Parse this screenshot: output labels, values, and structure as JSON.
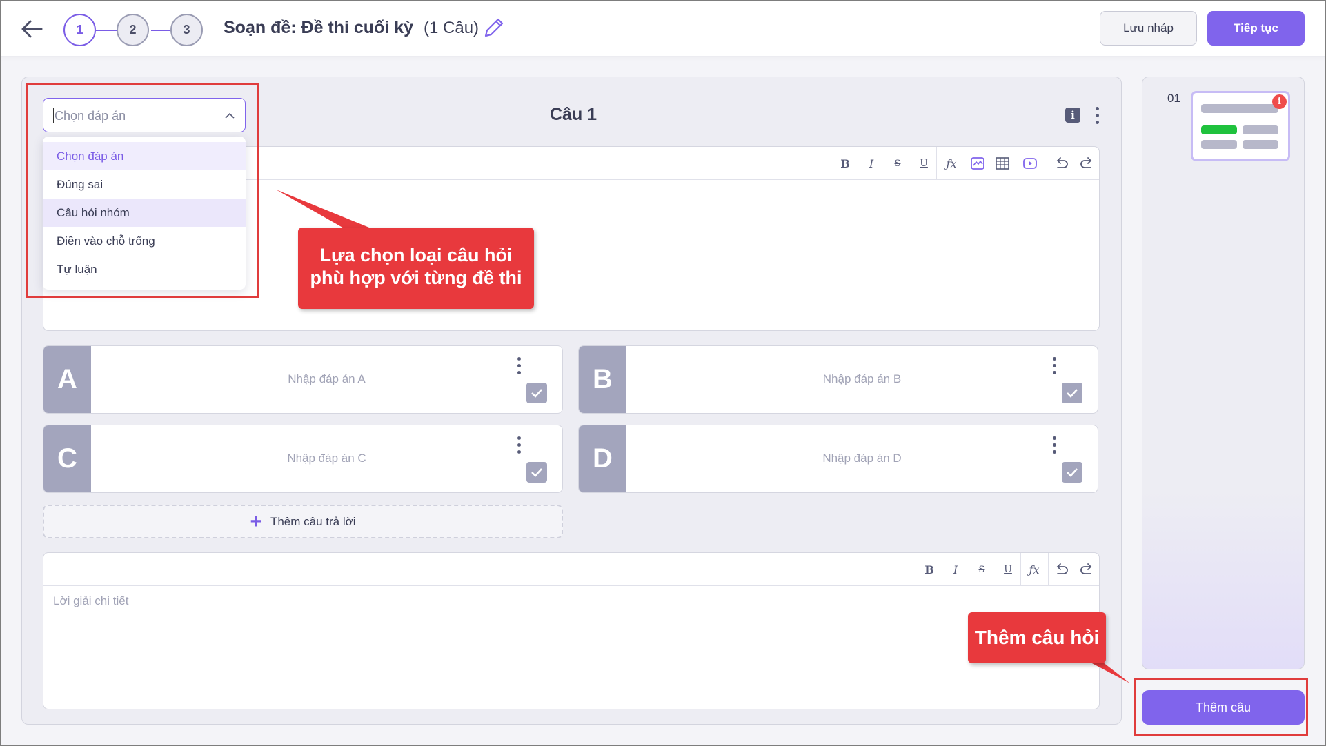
{
  "header": {
    "steps": [
      "1",
      "2",
      "3"
    ],
    "title": "Soạn đề: Đề thi cuối kỳ",
    "count": "(1 Câu)",
    "save_draft_label": "Lưu nháp",
    "continue_label": "Tiếp tục"
  },
  "question": {
    "heading": "Câu 1",
    "info_label": "i",
    "type_select": {
      "value": "Chọn đáp án",
      "options": [
        "Chọn đáp án",
        "Đúng sai",
        "Câu hỏi nhóm",
        "Điền vào chỗ trống",
        "Tự luận"
      ]
    },
    "toolbar": {
      "bold": "B",
      "italic": "I",
      "strike": "S",
      "underline": "U"
    },
    "answers": [
      {
        "letter": "A",
        "placeholder": "Nhập đáp án A"
      },
      {
        "letter": "B",
        "placeholder": "Nhập đáp án B"
      },
      {
        "letter": "C",
        "placeholder": "Nhập đáp án C"
      },
      {
        "letter": "D",
        "placeholder": "Nhập đáp án D"
      }
    ],
    "add_answer_label": "Thêm câu trả lời",
    "solution_placeholder": "Lời giải chi tiết"
  },
  "callouts": {
    "type_hint_line1": "Lựa chọn loại câu hỏi",
    "type_hint_line2": "phù hợp với từng đề thi",
    "add_question_hint": "Thêm câu hỏi"
  },
  "sidebar": {
    "question_number": "01",
    "warning_label": "i",
    "add_question_label": "Thêm câu"
  },
  "colors": {
    "accent": "#8064ec",
    "callout_red": "#e8393d",
    "correct_green": "#1fc23d"
  }
}
